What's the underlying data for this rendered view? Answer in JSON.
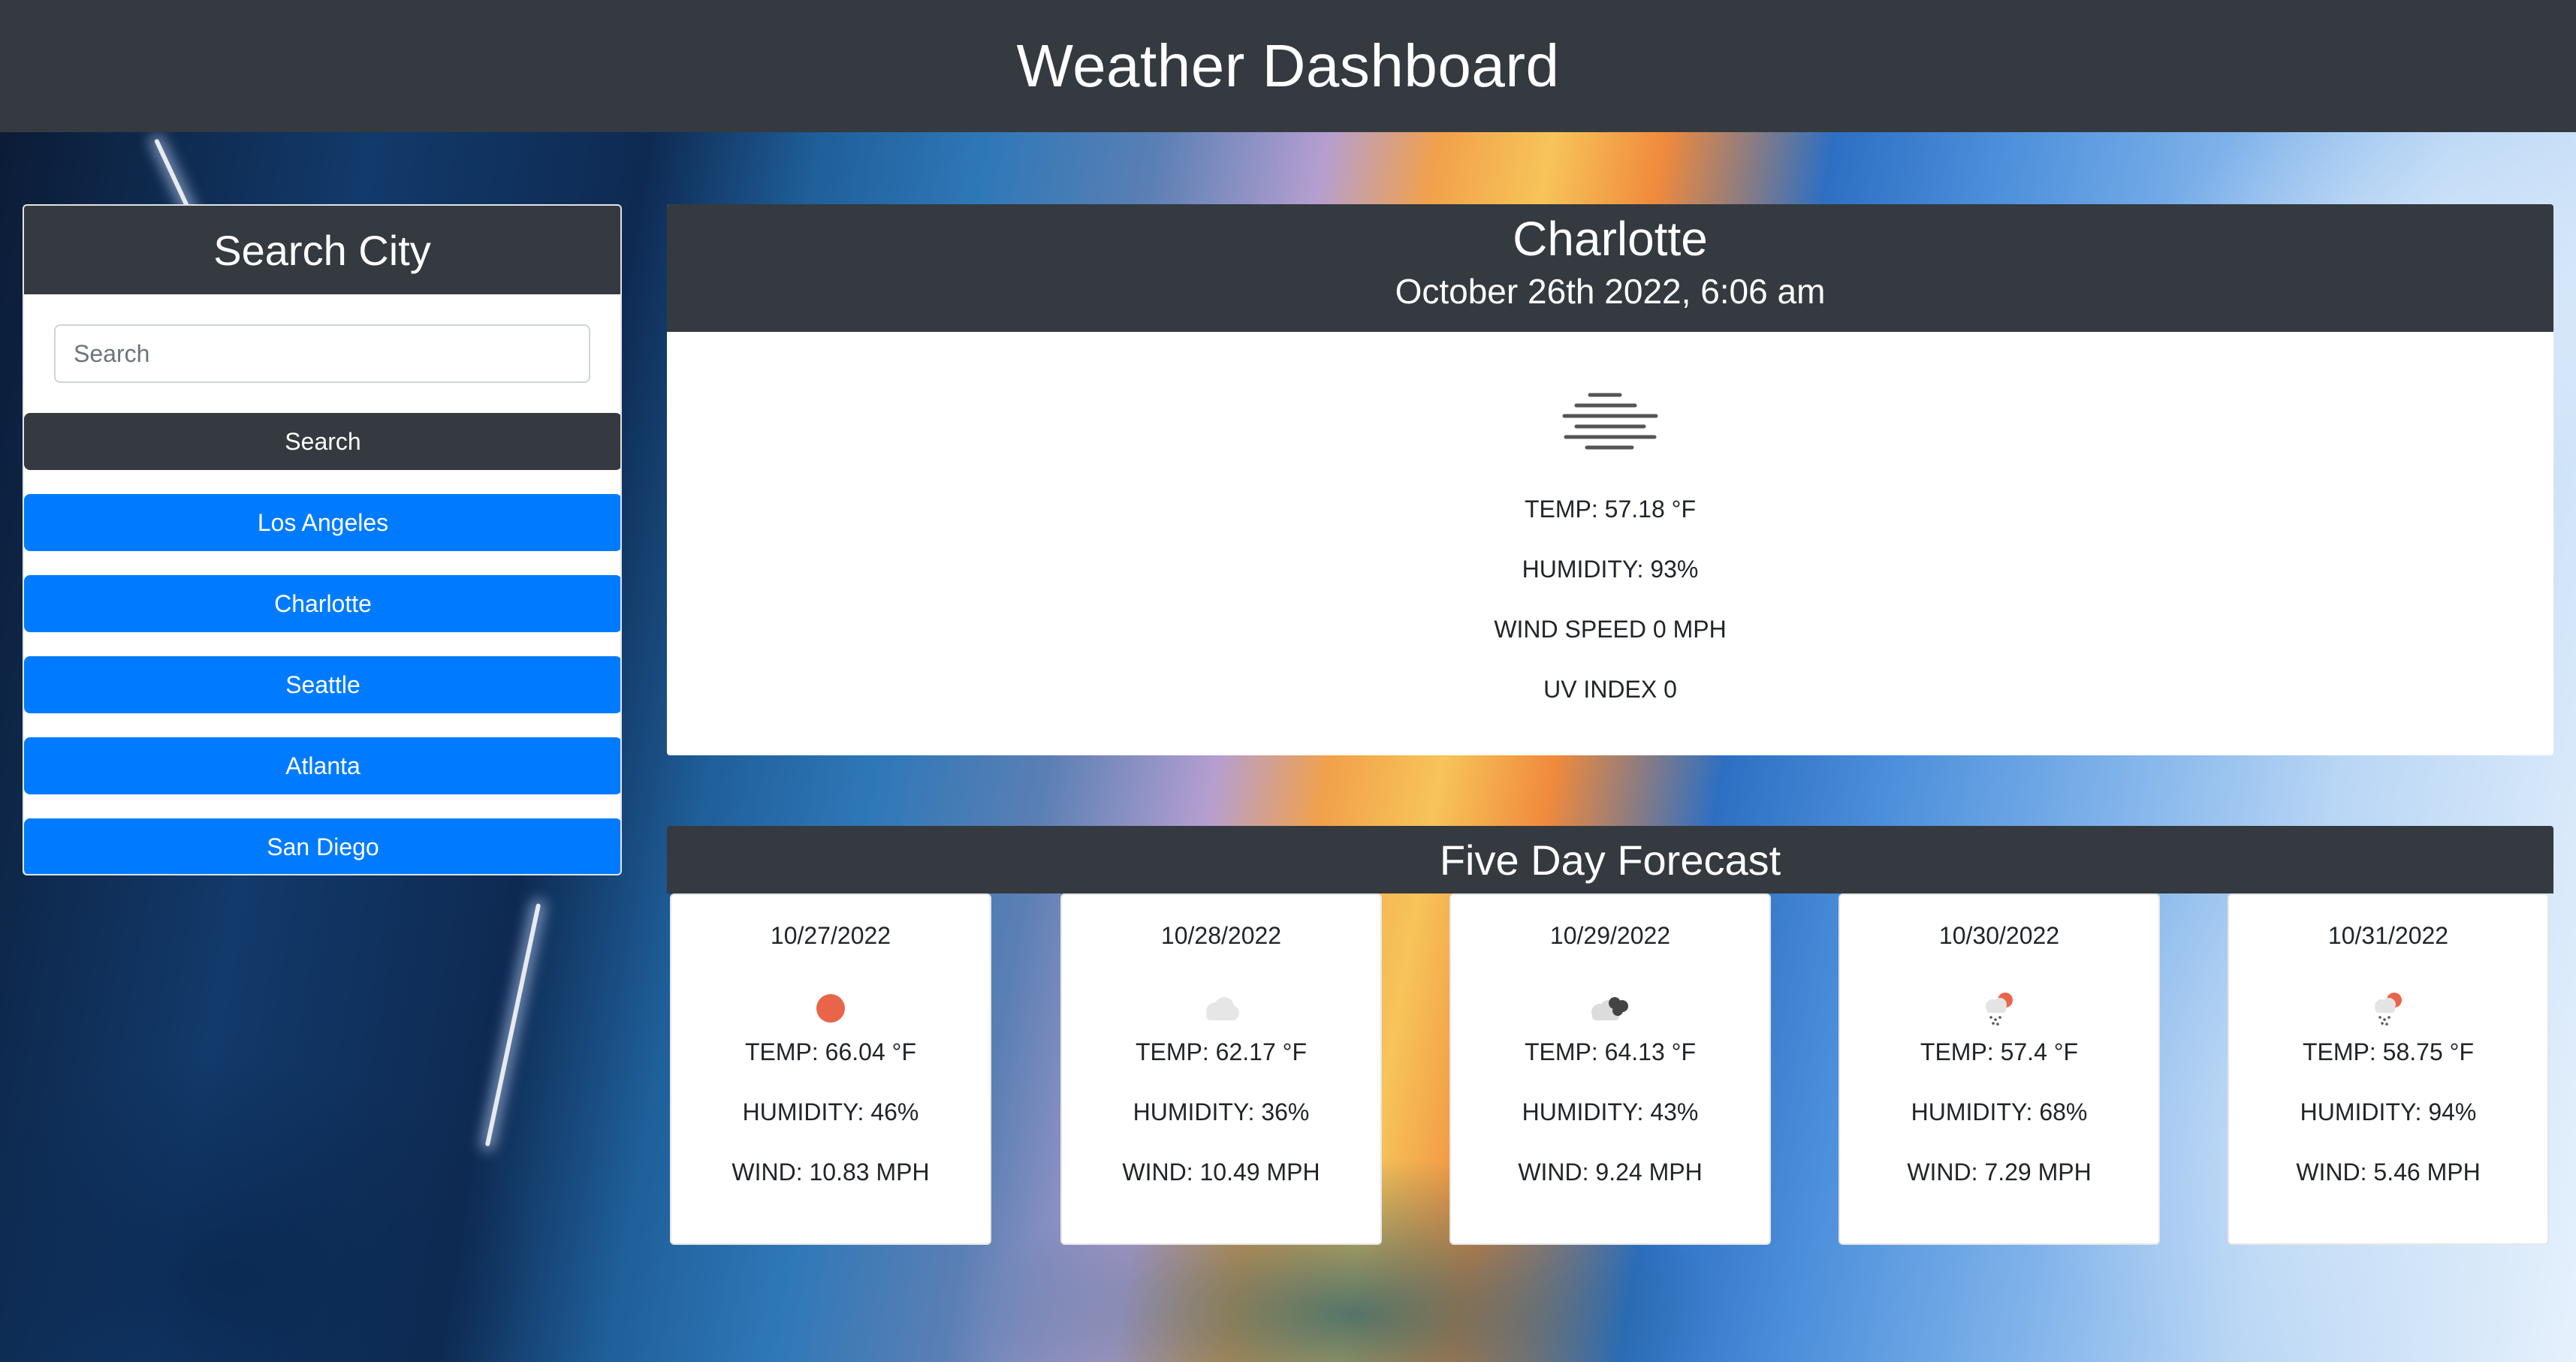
{
  "header": {
    "title": "Weather Dashboard"
  },
  "search": {
    "title": "Search City",
    "input_placeholder": "Search",
    "input_value": "",
    "button_label": "Search",
    "history": [
      "Los Angeles",
      "Charlotte",
      "Seattle",
      "Atlanta",
      "San Diego"
    ]
  },
  "current": {
    "city": "Charlotte",
    "datetime": "October 26th 2022, 6:06 am",
    "icon": "fog-icon",
    "temp": "TEMP: 57.18 °F",
    "humidity": "HUMIDITY: 93%",
    "wind": "WIND SPEED 0 MPH",
    "uv": "UV INDEX 0"
  },
  "forecast": {
    "title": "Five Day Forecast",
    "days": [
      {
        "date": "10/27/2022",
        "icon": "sun-icon",
        "temp": "TEMP: 66.04 °F",
        "humidity": "HUMIDITY: 46%",
        "wind": "WIND: 10.83 MPH"
      },
      {
        "date": "10/28/2022",
        "icon": "cloud-icon",
        "temp": "TEMP: 62.17 °F",
        "humidity": "HUMIDITY: 36%",
        "wind": "WIND: 10.49 MPH"
      },
      {
        "date": "10/29/2022",
        "icon": "broken-clouds-icon",
        "temp": "TEMP: 64.13 °F",
        "humidity": "HUMIDITY: 43%",
        "wind": "WIND: 9.24 MPH"
      },
      {
        "date": "10/30/2022",
        "icon": "rain-sun-icon",
        "temp": "TEMP: 57.4 °F",
        "humidity": "HUMIDITY: 68%",
        "wind": "WIND: 7.29 MPH"
      },
      {
        "date": "10/31/2022",
        "icon": "rain-sun-icon",
        "temp": "TEMP: 58.75 °F",
        "humidity": "HUMIDITY: 94%",
        "wind": "WIND: 5.46 MPH"
      }
    ]
  },
  "colors": {
    "header_bg": "#343a40",
    "city_button": "#007bff",
    "sun": "#e8654a"
  }
}
